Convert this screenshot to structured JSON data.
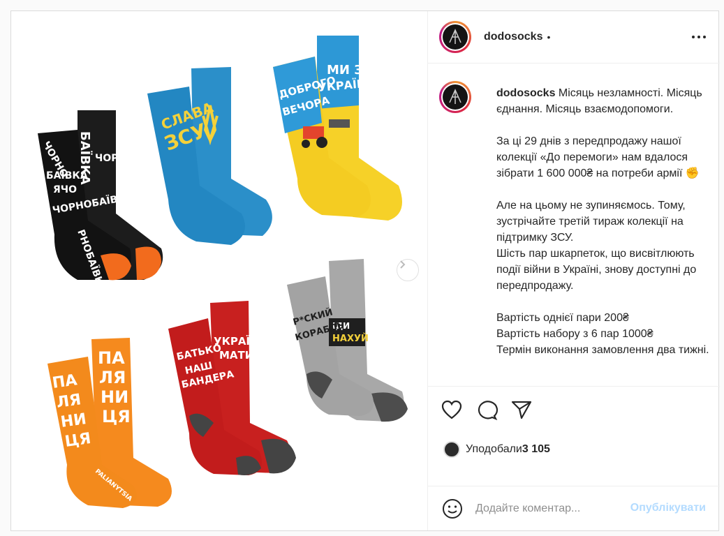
{
  "post": {
    "username": "dodosocks",
    "dot": "•",
    "caption_user": "dodosocks",
    "caption_text": "Місяць незламності. Місяць єднання. Місяць взаємодопомоги.\n\nЗа ці 29 днів з передпродажу нашої колекції «До перемоги» нам вдалося зібрати 1 600 000₴ на потреби армії ✊\n\nАле на цьому не зупиняємось. Тому, зустрічайте третій тираж колекції на підтримку ЗСУ.\nШість пар шкарпеток, що висвітлюють події війни в Україні, знову доступні до передпродажу.\n\nВартість однієї пари 200₴\nВартість набору з 6 пар 1000₴\nТермін виконання замовлення два тижні."
  },
  "likes": {
    "label": "Уподобали",
    "count": "3 105"
  },
  "comment": {
    "placeholder": "Додайте коментар...",
    "post_label": "Опублікувати"
  },
  "socks": {
    "black": [
      "ЧОРНО",
      "БАЇВКА",
      "ЧОРНО",
      "БАЇВКА",
      "ЯЧО",
      "ЧОРНОБАЇВКА",
      "РНОБАЇВКА",
      "ЧОРНОБА",
      "Я"
    ],
    "blue": [
      "СЛАВА",
      "ЗСУ"
    ],
    "yellow": [
      "ДОБРОГО",
      "ВЕЧОРА",
      "МИ З",
      "УКРАЇНИ"
    ],
    "orange": [
      "ПА",
      "ЛЯ",
      "НИ",
      "ЦЯ",
      "ПА",
      "ЛЯ",
      "НИ",
      "ЦЯ",
      "PALIANYTSIA"
    ],
    "red": [
      "БАТЬКО",
      "НАШ",
      "БАНДЕРА",
      "УКРАЇНА",
      "МАТИ"
    ],
    "grey": [
      "Р*СКИЙ",
      "КОРАБЛЬ",
      "ІДИ",
      "НАХУЙ"
    ]
  },
  "colors": {
    "accent": "#0095f6",
    "post_disabled": "#b3dbff",
    "border": "#dbdbdb"
  }
}
